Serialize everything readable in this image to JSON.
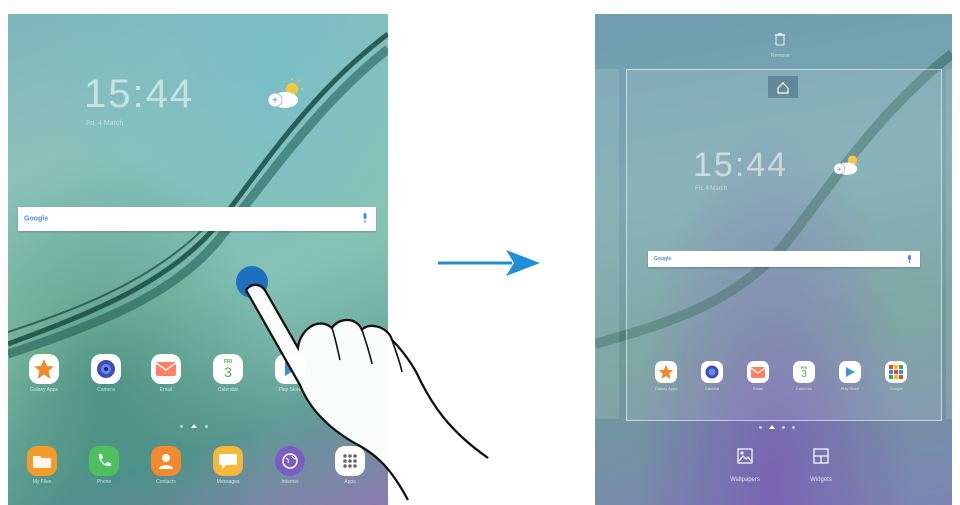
{
  "left_screen": {
    "clock": {
      "time": "15:44",
      "date": "Fri, 4 March"
    },
    "google_bar": {
      "text": "Google"
    },
    "apps": [
      {
        "label": "Galaxy Apps",
        "icon": "star-icon",
        "color": "#f08a2b"
      },
      {
        "label": "Camera",
        "icon": "camera-icon",
        "color": "#ffffff"
      },
      {
        "label": "Email",
        "icon": "email-icon",
        "color": "#ff7f5e"
      },
      {
        "label": "Calendar",
        "icon": "calendar-icon",
        "color": "#ffffff",
        "day_label": "FRI",
        "day": "3"
      },
      {
        "label": "Play Store",
        "icon": "play-store-icon",
        "color": "#ffffff"
      }
    ],
    "dock": [
      {
        "label": "My Files",
        "icon": "folder-icon",
        "color": "#f59b2c"
      },
      {
        "label": "Phone",
        "icon": "phone-icon",
        "color": "#4fbf5f"
      },
      {
        "label": "Contacts",
        "icon": "contacts-icon",
        "color": "#f28a2f"
      },
      {
        "label": "Messages",
        "icon": "messages-icon",
        "color": "#f5b83a"
      },
      {
        "label": "Internet",
        "icon": "internet-icon",
        "color": "#7a5ec4"
      },
      {
        "label": "Apps",
        "icon": "apps-grid-icon",
        "color": "#ffffff"
      }
    ]
  },
  "right_screen": {
    "remove_label": "Remove",
    "clock": {
      "time": "15:44",
      "date": "Fri, 4 March"
    },
    "google_bar": {
      "text": "Google"
    },
    "apps": [
      {
        "label": "Galaxy Apps",
        "icon": "star-icon",
        "color": "#f08a2b"
      },
      {
        "label": "Camera",
        "icon": "camera-icon",
        "color": "#ffffff"
      },
      {
        "label": "Email",
        "icon": "email-icon",
        "color": "#ff7f5e"
      },
      {
        "label": "Calendar",
        "icon": "calendar-icon",
        "color": "#ffffff",
        "day_label": "FRI",
        "day": "3"
      },
      {
        "label": "Play Store",
        "icon": "play-store-icon",
        "color": "#ffffff"
      },
      {
        "label": "Google",
        "icon": "google-folder-icon",
        "color": "#ffffff"
      }
    ],
    "buttons": {
      "wallpapers": "Wallpapers",
      "widgets": "Widgets"
    }
  },
  "arrow_color": "#1e8fd6"
}
